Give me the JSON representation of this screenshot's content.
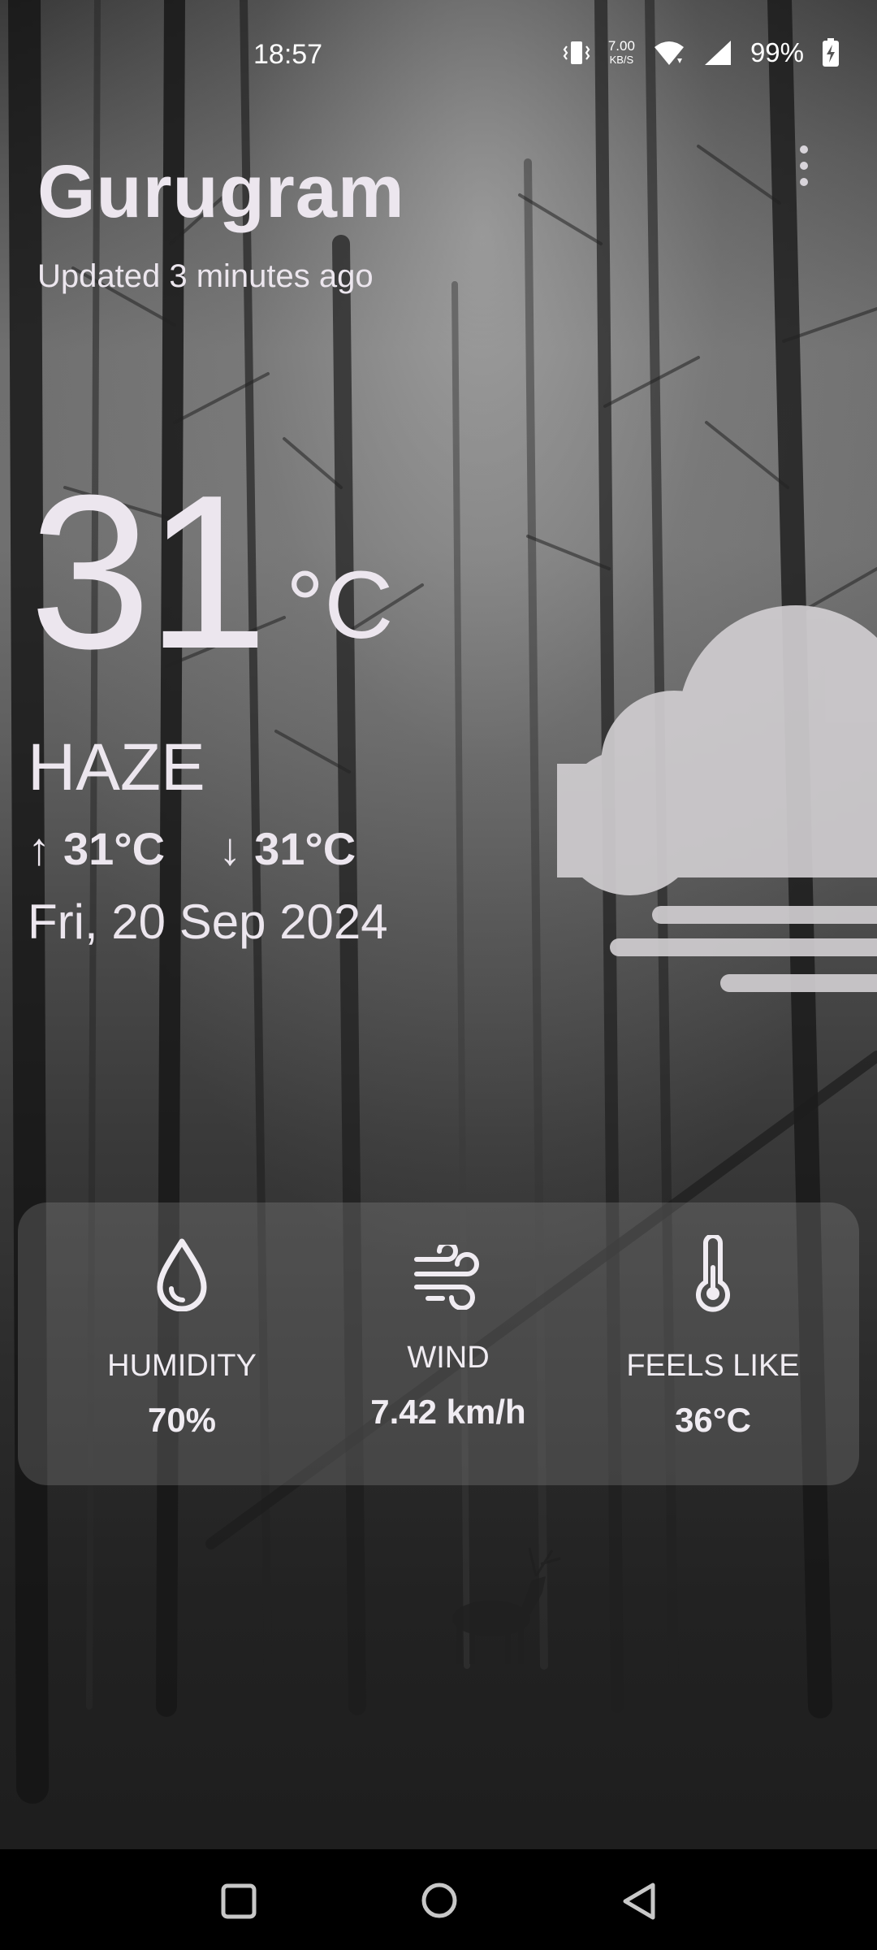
{
  "status_bar": {
    "time": "18:57",
    "network_speed_value": "7.00",
    "network_speed_unit": "KB/S",
    "battery": "99%",
    "icons": [
      "vibrate-icon",
      "wifi-icon",
      "signal-icon",
      "battery-charging-icon"
    ]
  },
  "location": {
    "city": "Gurugram",
    "updated": "Updated 3 minutes ago"
  },
  "current": {
    "temperature": "31",
    "unit": "°C",
    "condition": "HAZE",
    "high": "31°C",
    "low": "31°C",
    "high_arrow": "↑",
    "low_arrow": "↓",
    "date": "Fri, 20 Sep 2024",
    "condition_icon": "haze-cloud-icon"
  },
  "details": {
    "humidity": {
      "label": "HUMIDITY",
      "value": "70%",
      "icon": "drop-icon"
    },
    "wind": {
      "label": "WIND",
      "value": "7.42 km/h",
      "icon": "wind-icon"
    },
    "feels_like": {
      "label": "FEELS LIKE",
      "value": "36°C",
      "icon": "thermometer-icon"
    }
  },
  "navigation": [
    "recents-button",
    "home-button",
    "back-button"
  ]
}
